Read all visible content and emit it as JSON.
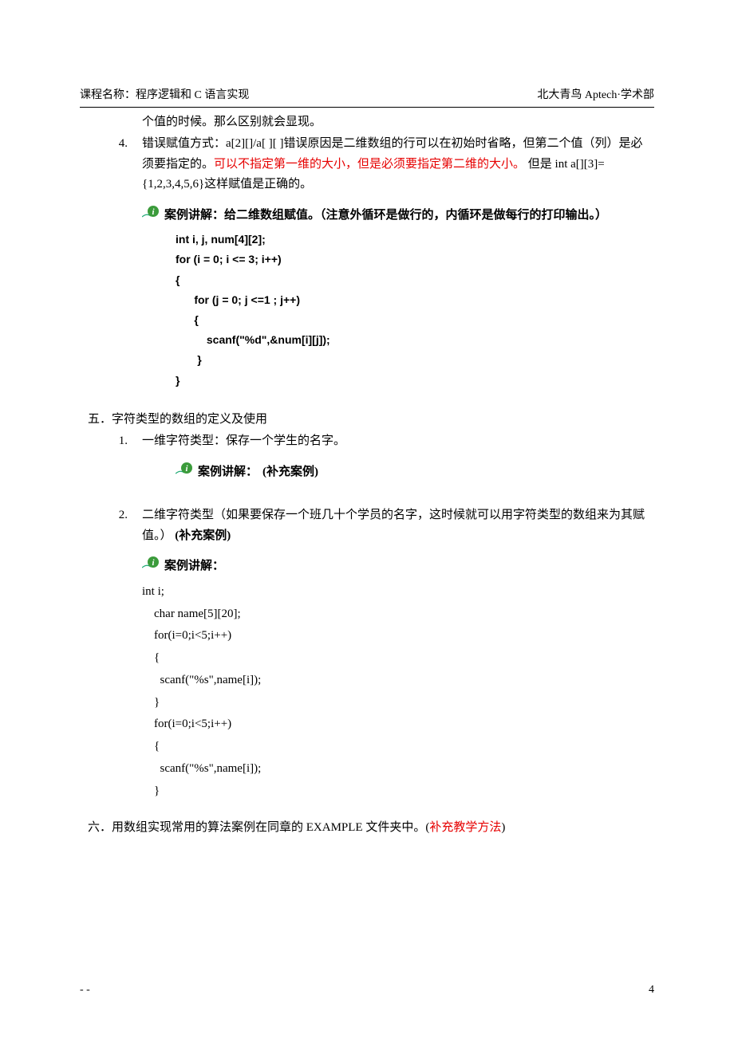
{
  "header": {
    "left_label": "课程名称：",
    "left_value": "程序逻辑和 C 语言实现",
    "right": "北大青鸟 Aptech·学术部"
  },
  "body": {
    "item3_tail": "个值的时候。那么区别就会显现。",
    "item4_num": "4.",
    "item4_a": "错误赋值方式：a[2][]/a[ ][ ]错误原因是二维数组的行可以在初始时省略，但第二个值（列）是必须要指定的。",
    "item4_b_red": "可以不指定第一维的大小，但是必须要指定第二维的大小。",
    "item4_c": "但是 int a[][3]={1,2,3,4,5,6}这样赋值是正确的。",
    "case1_label": "案例讲解：给二维数组赋值。（注意外循环是做行的，内循环是做每行的打印输出。）",
    "code1": "int i, j, num[4][2];\nfor (i = 0; i <= 3; i++)\n{\n      for (j = 0; j <=1 ; j++)\n      {\n          scanf(\"%d\",&num[i][j]);\n       }\n}",
    "sec5_title": "五．字符类型的数组的定义及使用",
    "sec5_1_num": "1.",
    "sec5_1_txt": "一维字符类型：保存一个学生的名字。",
    "case2_label": "案例讲解：",
    "case2_supp": "(补充案例)",
    "sec5_2_num": "2.",
    "sec5_2_txt_a": "二维字符类型（如果要保存一个班几十个学员的名字，这时候就可以用字符类型的数组来为其赋值。）",
    "sec5_2_supp": "(补充案例)",
    "case3_label": "案例讲解：",
    "code2": "int i;\n    char name[5][20];\n    for(i=0;i<5;i++)\n    {\n      scanf(\"%s\",name[i]);\n    }\n    for(i=0;i<5;i++)\n    {\n      scanf(\"%s\",name[i]);\n    }",
    "sec6_a": "六．用数组实现常用的算法案例在同章的 EXAMPLE 文件夹中。(",
    "sec6_red": "补充教学方法",
    "sec6_b": ")"
  },
  "footer": {
    "left": "-  -",
    "right": "4"
  }
}
